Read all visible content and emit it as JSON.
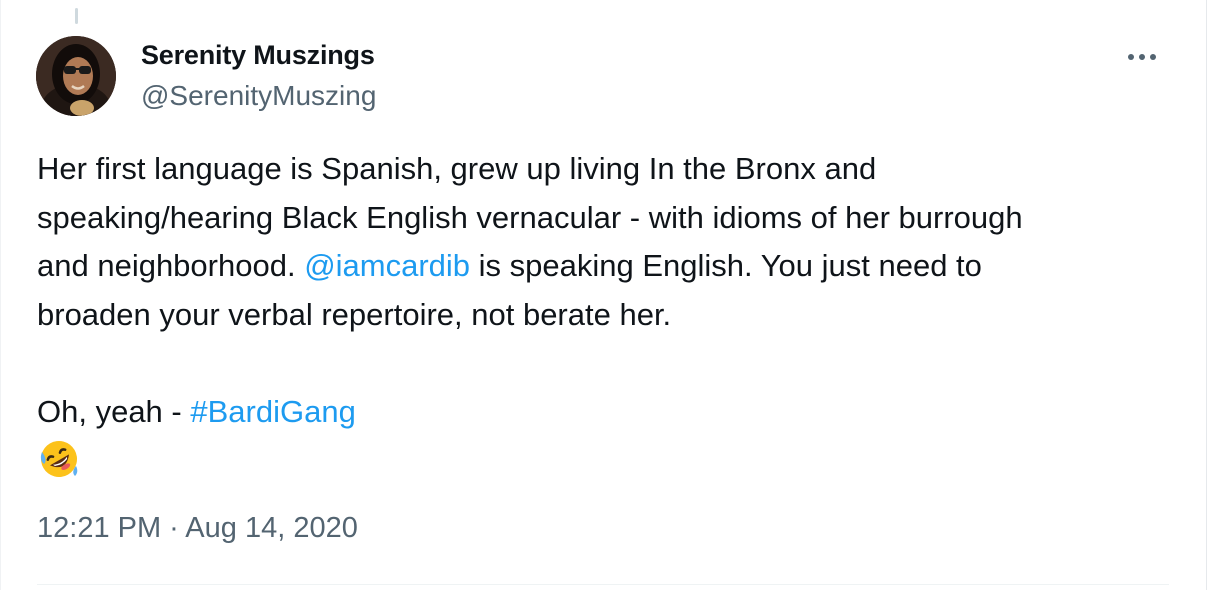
{
  "author": {
    "display_name": "Serenity Muszings",
    "handle": "@SerenityMuszing",
    "avatar_icon": "profile-photo"
  },
  "tweet": {
    "lines": [
      "Her first language is Spanish, grew up living In the Bronx and",
      "speaking/hearing Black English vernacular - with idioms of her burrough",
      "and neighborhood. ",
      " is speaking English. You just need to",
      "broaden your verbal repertoire, not berate her.",
      "Oh, yeah - "
    ],
    "mention": "@iamcardib",
    "hashtag": "#BardiGang",
    "emoji_icon": "rolling-on-the-floor-laughing-emoji"
  },
  "meta": {
    "timestamp": "12:21 PM · Aug 14, 2020"
  },
  "colors": {
    "link": "#1d9bf0",
    "secondary_text": "#536471",
    "primary_text": "#0f1419"
  }
}
